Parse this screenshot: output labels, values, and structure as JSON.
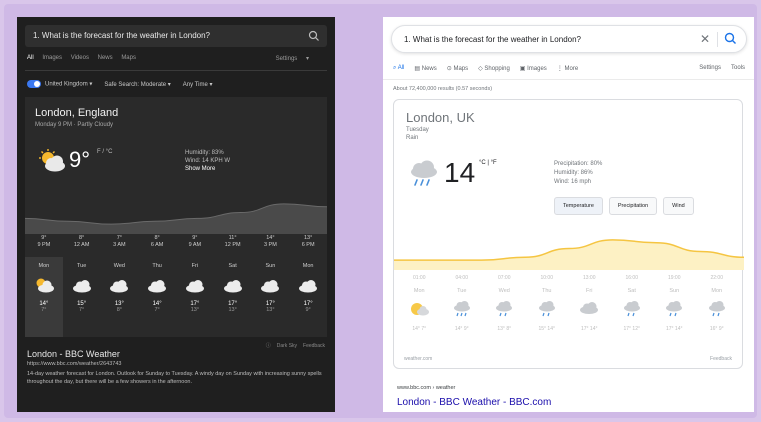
{
  "dark": {
    "query": "1. What is the forecast for the weather in London?",
    "tabs": [
      "All",
      "Images",
      "Videos",
      "News",
      "Maps"
    ],
    "settings_label": "Settings",
    "filters": [
      "United Kingdom",
      "Safe Search: Moderate",
      "Any Time"
    ],
    "city": "London, England",
    "condition": "Monday 9 PM · Partly Cloudy",
    "temp": "9°",
    "units": "F / °C",
    "details": [
      "Humidity: 83%",
      "Wind: 14 KPH W"
    ],
    "show_more": "Show More",
    "temp_curve": [
      9,
      8,
      7,
      8,
      9,
      11,
      14,
      13
    ],
    "hours": [
      {
        "t": "9°",
        "h": "9 PM"
      },
      {
        "t": "8°",
        "h": "12 AM"
      },
      {
        "t": "7°",
        "h": "3 AM"
      },
      {
        "t": "8°",
        "h": "6 AM"
      },
      {
        "t": "9°",
        "h": "9 AM"
      },
      {
        "t": "11°",
        "h": "12 PM"
      },
      {
        "t": "14°",
        "h": "3 PM"
      },
      {
        "t": "13°",
        "h": "6 PM"
      }
    ],
    "days": [
      {
        "n": "Mon",
        "hi": "14°",
        "lo": "7°",
        "icon": "partly-sunny-icon"
      },
      {
        "n": "Tue",
        "hi": "15°",
        "lo": "7°",
        "icon": "cloud-icon"
      },
      {
        "n": "Wed",
        "hi": "13°",
        "lo": "8°",
        "icon": "cloud-icon"
      },
      {
        "n": "Thu",
        "hi": "14°",
        "lo": "7°",
        "icon": "cloud-icon"
      },
      {
        "n": "Fri",
        "hi": "17°",
        "lo": "13°",
        "icon": "cloud-icon"
      },
      {
        "n": "Sat",
        "hi": "17°",
        "lo": "13°",
        "icon": "cloud-icon"
      },
      {
        "n": "Sun",
        "hi": "17°",
        "lo": "13°",
        "icon": "cloud-icon"
      },
      {
        "n": "Mon",
        "hi": "17°",
        "lo": "9°",
        "icon": "cloud-icon"
      }
    ],
    "footer": [
      "Dark Sky",
      "Feedback"
    ],
    "result": {
      "title": "London - BBC Weather",
      "url": "https://www.bbc.com/weather/2643743",
      "desc": "14-day weather forecast for London. Outlook for Sunday to Tuesday. A windy day on Sunday with increasing sunny spells throughout the day, but there will be a few showers in the afternoon."
    }
  },
  "light": {
    "query": "1.   What is the forecast for the weather in London?",
    "tabs": [
      "All",
      "News",
      "Maps",
      "Shopping",
      "Images",
      "More"
    ],
    "right_tabs": [
      "Settings",
      "Tools"
    ],
    "count": "About 72,400,000 results (0.57 seconds)",
    "city": "London, UK",
    "day": "Tuesday",
    "condition": "Rain",
    "temp": "14",
    "units": "°C | °F",
    "details": [
      "Precipitation: 80%",
      "Humidity: 86%",
      "Wind: 16 mph"
    ],
    "buttons": [
      "Temperature",
      "Precipitation",
      "Wind"
    ],
    "temp_curve": [
      8,
      8,
      8,
      9,
      12,
      15,
      14,
      11,
      9
    ],
    "hours": [
      "01:00",
      "04:00",
      "07:00",
      "10:00",
      "13:00",
      "16:00",
      "19:00",
      "22:00"
    ],
    "days": [
      {
        "n": "Mon",
        "t": "14° 7°"
      },
      {
        "n": "Tue",
        "t": "14° 9°"
      },
      {
        "n": "Wed",
        "t": "13° 8°"
      },
      {
        "n": "Thu",
        "t": "15° 14°"
      },
      {
        "n": "Fri",
        "t": "17° 14°"
      },
      {
        "n": "Sat",
        "t": "17° 12°"
      },
      {
        "n": "Sun",
        "t": "17° 14°"
      },
      {
        "n": "Mon",
        "t": "16° 9°"
      }
    ],
    "source": "weather.com",
    "feedback": "Feedback",
    "result": {
      "url": "www.bbc.com › weather",
      "title": "London - BBC Weather - BBC.com"
    }
  }
}
